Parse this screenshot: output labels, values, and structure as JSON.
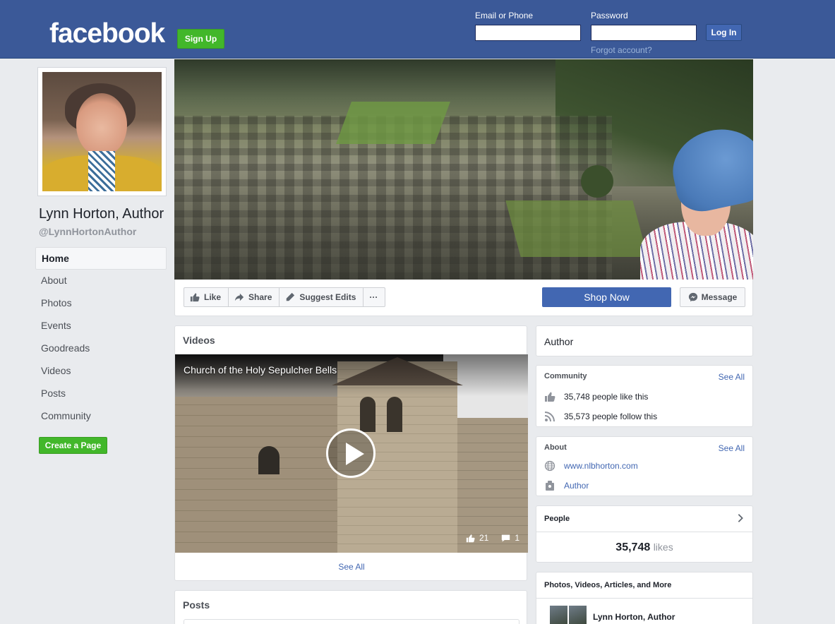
{
  "header": {
    "logo": "facebook",
    "signup_label": "Sign Up",
    "email_label": "Email or Phone",
    "password_label": "Password",
    "login_label": "Log In",
    "forgot_label": "Forgot account?",
    "brand_color": "#3b5998"
  },
  "profile": {
    "name": "Lynn Horton, Author",
    "handle": "@LynnHortonAuthor"
  },
  "leftnav": {
    "items": [
      {
        "label": "Home",
        "active": true
      },
      {
        "label": "About"
      },
      {
        "label": "Photos"
      },
      {
        "label": "Events"
      },
      {
        "label": "Goodreads"
      },
      {
        "label": "Videos"
      },
      {
        "label": "Posts"
      },
      {
        "label": "Community"
      }
    ],
    "create_page_label": "Create a Page"
  },
  "actions": {
    "like": "Like",
    "share": "Share",
    "suggest": "Suggest Edits",
    "more": "···",
    "shop": "Shop Now",
    "message": "Message"
  },
  "videos": {
    "title": "Videos",
    "video_title": "Church of the Holy Sepulcher Bells",
    "likes": "21",
    "comments": "1",
    "see_all": "See All"
  },
  "posts": {
    "title": "Posts"
  },
  "sidebar": {
    "category": "Author",
    "community": {
      "title": "Community",
      "see_all": "See All",
      "likes_text": "35,748 people like this",
      "follows_text": "35,573 people follow this"
    },
    "about": {
      "title": "About",
      "see_all": "See All",
      "website": "www.nlbhorton.com",
      "category": "Author"
    },
    "people": {
      "title": "People",
      "count": "35,748",
      "unit": "likes"
    },
    "photos": {
      "title": "Photos, Videos, Articles, and More",
      "page_name": "Lynn Horton, Author"
    }
  }
}
